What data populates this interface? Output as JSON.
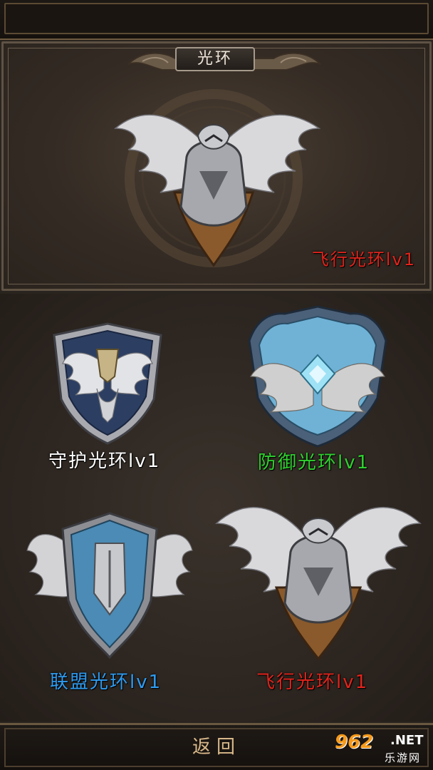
{
  "header": {
    "title": "光环"
  },
  "featured": {
    "label": "飞行光环lv1",
    "label_color": "#e0241c",
    "icon": "winged-eagle-emblem-icon"
  },
  "auras": [
    {
      "label": "守护光环lv1",
      "color": "#ffffff",
      "icon": "guardian-shield-wings-icon"
    },
    {
      "label": "防御光环lv1",
      "color": "#2fd12f",
      "icon": "defense-crystal-shield-icon"
    },
    {
      "label": "联盟光环lv1",
      "color": "#2e9bf0",
      "icon": "alliance-blue-shield-wings-icon"
    },
    {
      "label": "飞行光环lv1",
      "color": "#e0241c",
      "icon": "flight-eagle-emblem-icon"
    }
  ],
  "footer": {
    "back_label": "返回"
  },
  "watermark": {
    "logo": "962",
    "net": ".NET",
    "sub": "乐游网"
  }
}
